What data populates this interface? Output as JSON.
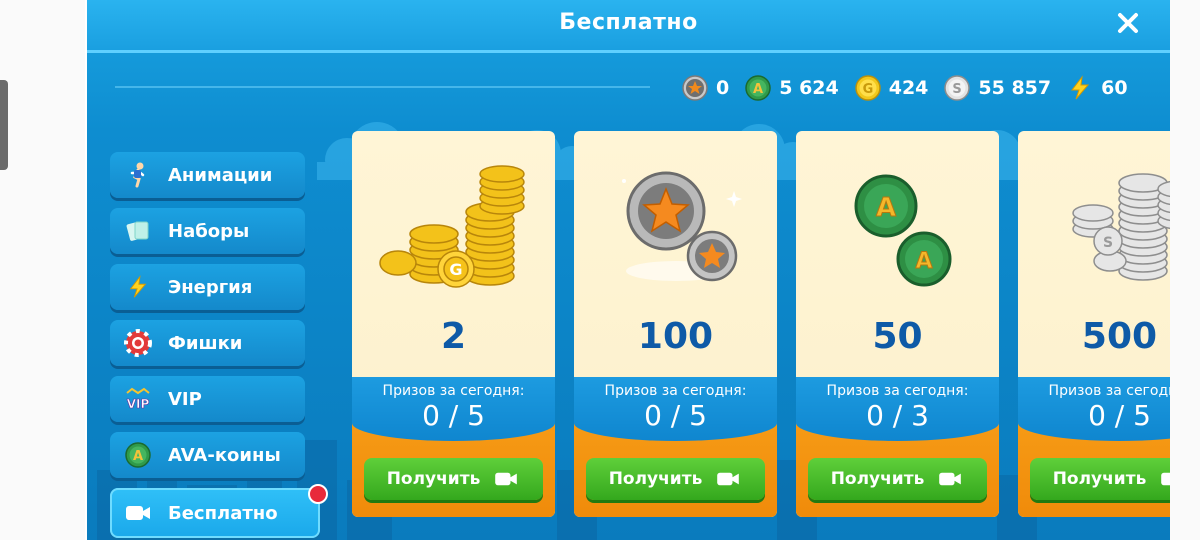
{
  "window": {
    "title": "Бесплатно",
    "close_icon": "close-icon"
  },
  "currencies": [
    {
      "icon": "star-coin-icon",
      "value": "0"
    },
    {
      "icon": "ava-coin-icon",
      "value": "5 624"
    },
    {
      "icon": "gold-coin-icon",
      "value": "424"
    },
    {
      "icon": "silver-coin-icon",
      "value": "55 857"
    },
    {
      "icon": "lightning-icon",
      "value": "60"
    }
  ],
  "sidebar": {
    "items": [
      {
        "label": "Анимации",
        "icon": "running-man-icon"
      },
      {
        "label": "Наборы",
        "icon": "cards-icon"
      },
      {
        "label": "Энергия",
        "icon": "lightning-icon"
      },
      {
        "label": "Фишки",
        "icon": "poker-chip-icon"
      },
      {
        "label": "VIP",
        "icon": "vip-icon"
      },
      {
        "label": "AVA-коины",
        "icon": "ava-coin-icon"
      },
      {
        "label": "Бесплатно",
        "icon": "video-camera-icon",
        "active": true
      }
    ]
  },
  "cards": [
    {
      "art": "gold-coins-pile",
      "amount": "2",
      "prize_label": "Призов за сегодня:",
      "prize_count": "0 / 5",
      "button": "Получить",
      "button_icon": "video-camera-icon"
    },
    {
      "art": "star-coins",
      "amount": "100",
      "prize_label": "Призов за сегодня:",
      "prize_count": "0 / 5",
      "button": "Получить",
      "button_icon": "video-camera-icon"
    },
    {
      "art": "ava-coins",
      "amount": "50",
      "prize_label": "Призов за сегодня:",
      "prize_count": "0 / 3",
      "button": "Получить",
      "button_icon": "video-camera-icon"
    },
    {
      "art": "silver-coins-pile",
      "amount": "500",
      "prize_label": "Призов за сегодня:",
      "prize_count": "0 / 5",
      "button": "Получить",
      "button_icon": "video-camera-icon"
    }
  ],
  "colors": {
    "panel_blue": "#0e8dd0",
    "card_cream": "#fff5d6",
    "button_green": "#4cbf2e",
    "amount_blue": "#0e5aa7",
    "orange": "#f39511"
  }
}
